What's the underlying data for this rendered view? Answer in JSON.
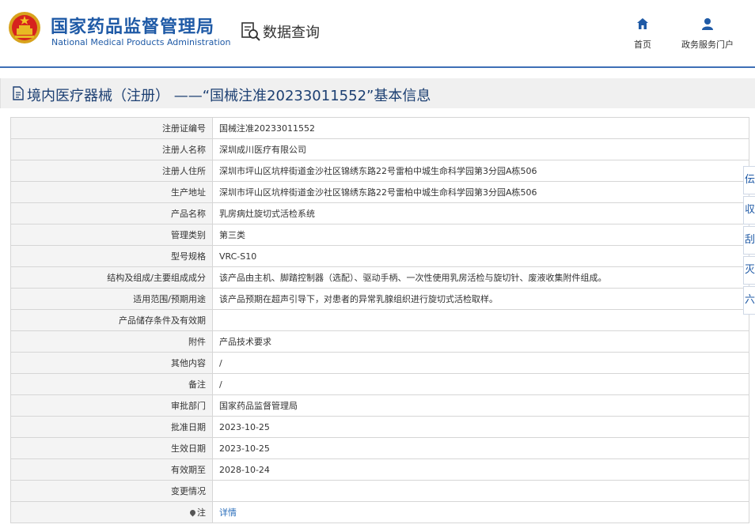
{
  "header": {
    "agency_cn": "国家药品监督管理局",
    "agency_en": "National Medical Products Administration",
    "query_label": "数据查询",
    "nav_home": "首页",
    "nav_portal": "政务服务门户",
    "accent_color": "#1f5aa6"
  },
  "page_title": "境内医疗器械（注册） ——“国械注准20233011552”基本信息",
  "rows": [
    {
      "label": "注册证编号",
      "value": "国械注准20233011552"
    },
    {
      "label": "注册人名称",
      "value": "深圳成川医疗有限公司"
    },
    {
      "label": "注册人住所",
      "value": "深圳市坪山区坑梓街道金沙社区锦绣东路22号雷柏中城生命科学园第3分园A栋506"
    },
    {
      "label": "生产地址",
      "value": "深圳市坪山区坑梓街道金沙社区锦绣东路22号雷柏中城生命科学园第3分园A栋506"
    },
    {
      "label": "产品名称",
      "value": "乳房病灶旋切式活检系统"
    },
    {
      "label": "管理类别",
      "value": "第三类"
    },
    {
      "label": "型号规格",
      "value": "VRC-S10"
    },
    {
      "label": "结构及组成/主要组成成分",
      "value": "该产品由主机、脚踏控制器（选配）、驱动手柄、一次性使用乳房活检与旋切针、废液收集附件组成。"
    },
    {
      "label": "适用范围/预期用途",
      "value": "该产品预期在超声引导下，对患者的异常乳腺组织进行旋切式活检取样。"
    },
    {
      "label": "产品储存条件及有效期",
      "value": ""
    },
    {
      "label": "附件",
      "value": "产品技术要求"
    },
    {
      "label": "其他内容",
      "value": "/"
    },
    {
      "label": "备注",
      "value": "/"
    },
    {
      "label": "审批部门",
      "value": "国家药品监督管理局"
    },
    {
      "label": "批准日期",
      "value": "2023-10-25"
    },
    {
      "label": "生效日期",
      "value": "2023-10-25"
    },
    {
      "label": "有效期至",
      "value": "2028-10-24"
    },
    {
      "label": "变更情况",
      "value": ""
    },
    {
      "label": "注",
      "value": "详情"
    }
  ],
  "side_tools": [
    "伝",
    "収",
    "刮",
    "灭",
    "六"
  ]
}
